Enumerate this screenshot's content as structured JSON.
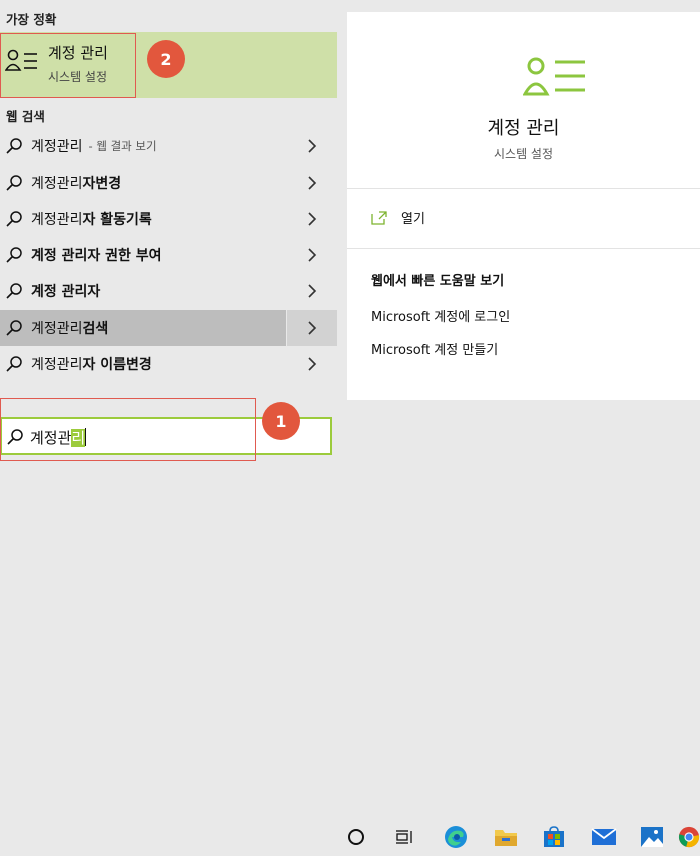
{
  "left": {
    "best_match_header": "가장 정확",
    "best_match": {
      "title": "계정 관리",
      "subtitle": "시스템 설정",
      "icon": "person-list-icon"
    },
    "web_header": "웹 검색",
    "results": [
      {
        "prefix": "계정관리",
        "bold": "",
        "hint": "- 웹 결과 보기"
      },
      {
        "prefix": "계정관리",
        "bold": "자변경",
        "hint": ""
      },
      {
        "prefix": "계정관리",
        "bold": "자 활동기록",
        "hint": ""
      },
      {
        "prefix": "",
        "bold": "계정 관리자 권한 부여",
        "hint": ""
      },
      {
        "prefix": "",
        "bold": "계정 관리자",
        "hint": ""
      },
      {
        "prefix": "계정관리",
        "bold": "검색",
        "hint": ""
      },
      {
        "prefix": "계정관리",
        "bold": "자 이름변경",
        "hint": ""
      }
    ]
  },
  "right": {
    "title": "계정 관리",
    "subtitle": "시스템 설정",
    "open_label": "열기",
    "web_help_title": "웹에서 빠른 도움말 보기",
    "links": [
      "Microsoft 계정에 로그인",
      "Microsoft 계정 만들기"
    ]
  },
  "search": {
    "query_plain": "계정관",
    "query_selected": "리"
  },
  "annotations": {
    "badge1": "1",
    "badge2": "2"
  },
  "taskbar": {
    "icons": [
      "cortana-icon",
      "task-view-icon",
      "edge-icon",
      "file-explorer-icon",
      "store-icon",
      "mail-icon",
      "photos-icon",
      "chrome-icon"
    ]
  },
  "colors": {
    "accent_green": "#9ccb3c",
    "best_match_bg": "#cfe0a8",
    "annotation_red": "#e2573d",
    "selected_row": "#bdbdbd"
  }
}
